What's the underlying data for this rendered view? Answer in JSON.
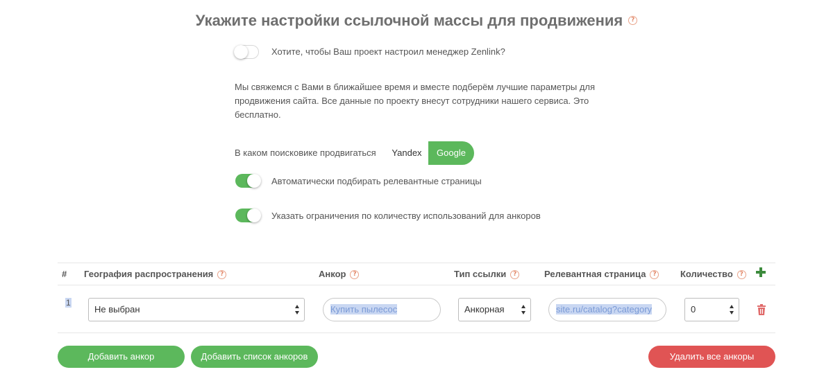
{
  "header": {
    "title": "Укажите настройки ссылочной массы для продвижения"
  },
  "manager": {
    "toggle_on": false,
    "label": "Хотите, чтобы Ваш проект настроил менеджер Zenlink?",
    "description": "Мы свяжемся с Вами в ближайшее время и вместе подберём лучшие параметры для продвижения сайта. Все данные по проекту внесут сотрудники нашего сервиса. Это бесплатно."
  },
  "search_engine": {
    "label": "В каком поисковике продвигаться",
    "options": [
      "Yandex",
      "Google"
    ],
    "selected": "Google"
  },
  "auto_pages": {
    "toggle_on": true,
    "label": "Автоматически подбирать релевантные страницы"
  },
  "anchor_limits": {
    "toggle_on": true,
    "label": "Указать ограничения по количеству использований для анкоров"
  },
  "table": {
    "headers": {
      "num": "#",
      "geo": "География распространения",
      "anchor": "Анкор",
      "link_type": "Тип ссылки",
      "page": "Релевантная страница",
      "qty": "Количество"
    },
    "rows": [
      {
        "num": "1",
        "geo": "Не выбран",
        "anchor_placeholder": "Купить пылесос",
        "link_type": "Анкорная",
        "page_placeholder": "site.ru/catalog?category",
        "qty": "0"
      }
    ]
  },
  "actions": {
    "add_anchor": "Добавить анкор",
    "add_anchor_list": "Добавить список анкоров",
    "delete_all": "Удалить все анкоры"
  },
  "colors": {
    "accent_green": "#5cb85c",
    "danger_red": "#e05454",
    "help_orange": "#e28565"
  }
}
